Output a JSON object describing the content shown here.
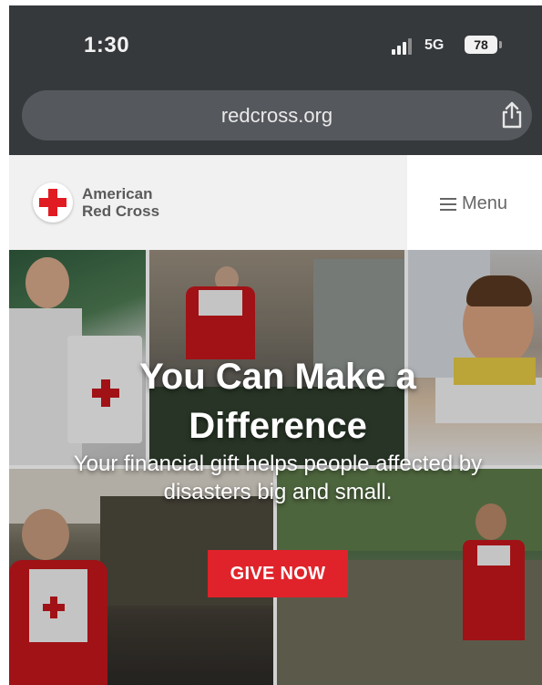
{
  "status_bar": {
    "time": "1:30",
    "network": "5G",
    "battery": "78"
  },
  "browser": {
    "url": "redcross.org",
    "share_icon": "share-icon"
  },
  "header": {
    "logo_line1": "American",
    "logo_line2": "Red Cross",
    "menu_label": "Menu",
    "menu_icon": "hamburger-icon"
  },
  "hero": {
    "title_line1": "You Can Make a",
    "title_line2": "Difference",
    "subtitle_line1": "Your financial gift helps people affected by",
    "subtitle_line2": "disasters big and small.",
    "cta_label": "GIVE NOW"
  },
  "colors": {
    "brand_red": "#e11b22",
    "chrome_dark": "#36393c",
    "url_pill": "#55585c"
  }
}
